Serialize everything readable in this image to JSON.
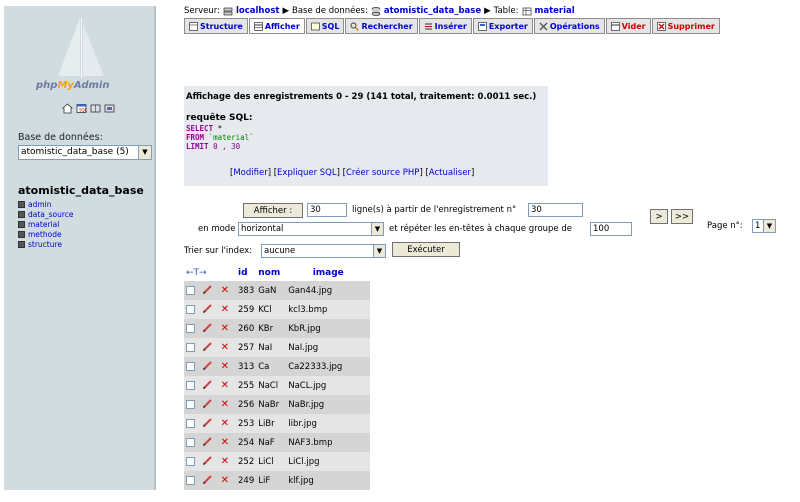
{
  "sidebar": {
    "logo": {
      "php": "php",
      "my": "My",
      "admin": "Admin"
    },
    "db_label": "Base de données:",
    "db_select": "atomistic_data_base (5)",
    "db_title": "atomistic_data_base",
    "tables": [
      "admin",
      "data_source",
      "material",
      "methode",
      "structure"
    ]
  },
  "breadcrumb": {
    "server_label": "Serveur:",
    "server": "localhost",
    "db_label": "Base de données:",
    "db": "atomistic_data_base",
    "table_label": "Table:",
    "table": "material"
  },
  "tabs": [
    {
      "label": "Structure",
      "icon": "structure-icon"
    },
    {
      "label": "Afficher",
      "icon": "browse-icon"
    },
    {
      "label": "SQL",
      "icon": "sql-icon"
    },
    {
      "label": "Rechercher",
      "icon": "search-icon"
    },
    {
      "label": "Insérer",
      "icon": "insert-icon"
    },
    {
      "label": "Exporter",
      "icon": "export-icon"
    },
    {
      "label": "Opérations",
      "icon": "operations-icon"
    },
    {
      "label": "Vider",
      "icon": "empty-icon"
    },
    {
      "label": "Supprimer",
      "icon": "drop-icon"
    }
  ],
  "info": {
    "summary": "Affichage des enregistrements 0 - 29 (141 total, traitement: 0.0011 sec.)",
    "sql_label": "requête SQL:",
    "sql_select": "SELECT",
    "sql_star": " *",
    "sql_from": "FROM",
    "sql_table": " `material`",
    "sql_limit": "LIMIT",
    "sql_limit_args": " 0 , 30",
    "links": [
      "Modifier",
      "Expliquer SQL",
      "Créer source PHP",
      "Actualiser"
    ]
  },
  "nav": {
    "show_button": "Afficher :",
    "rows": "30",
    "rows_text": "ligne(s) à partir de l'enregistrement n°",
    "start": "30",
    "mode_label": "en mode",
    "mode_value": "horizontal",
    "repeat_text": "et répéter les en-têtes à chaque groupe de",
    "repeat_value": "100",
    "next_button": ">",
    "last_button": ">>",
    "page_label": "Page n°:",
    "page_value": "1",
    "sort_label": "Trier sur l'index:",
    "sort_value": "aucune",
    "execute_button": "Exécuter"
  },
  "table": {
    "arrows": "←T→",
    "columns": [
      "id",
      "nom",
      "image"
    ],
    "rows": [
      {
        "id": "383",
        "nom": "GaN",
        "image": "Gan44.jpg"
      },
      {
        "id": "259",
        "nom": "KCl",
        "image": "kcl3.bmp"
      },
      {
        "id": "260",
        "nom": "KBr",
        "image": "KbR.jpg"
      },
      {
        "id": "257",
        "nom": "NaI",
        "image": "NaI.jpg"
      },
      {
        "id": "313",
        "nom": "Ca",
        "image": "Ca22333.jpg"
      },
      {
        "id": "255",
        "nom": "NaCl",
        "image": "NaCL.jpg"
      },
      {
        "id": "256",
        "nom": "NaBr",
        "image": "NaBr.jpg"
      },
      {
        "id": "253",
        "nom": "LiBr",
        "image": "libr.jpg"
      },
      {
        "id": "254",
        "nom": "NaF",
        "image": "NAF3.bmp"
      },
      {
        "id": "252",
        "nom": "LiCl",
        "image": "LiCl.jpg"
      },
      {
        "id": "249",
        "nom": "LiF",
        "image": "klf.jpg"
      }
    ]
  }
}
